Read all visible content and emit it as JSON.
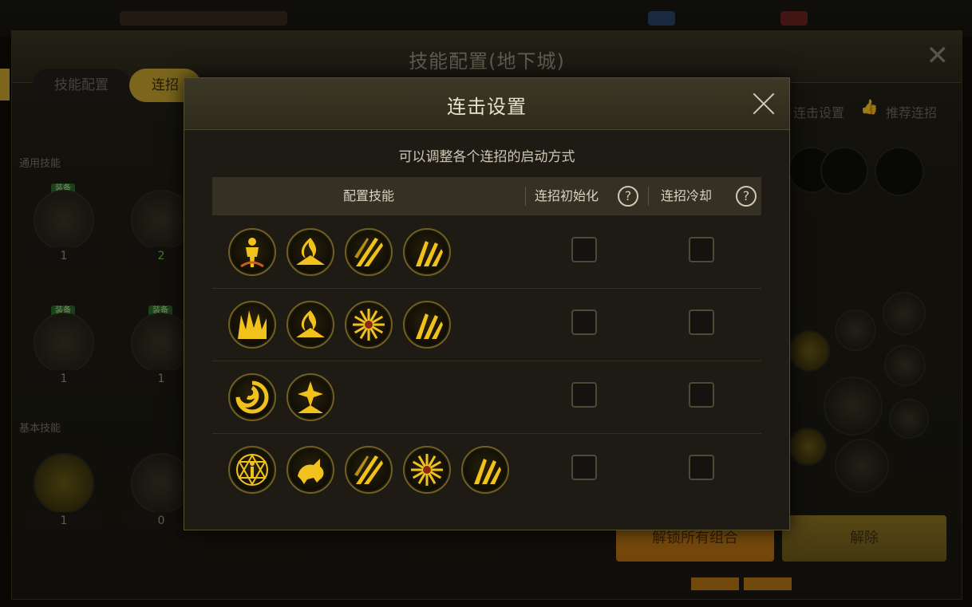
{
  "background": {
    "window_title": "技能配置(地下城)",
    "tabs": [
      {
        "label": "技能配置"
      },
      {
        "label": "连招"
      }
    ],
    "sections": {
      "common": "通用技能",
      "basic": "基本技能"
    },
    "badges": [
      "装备",
      "装备",
      "装备"
    ],
    "skill_levels": [
      "1",
      "2",
      "1",
      "1",
      "1",
      "0"
    ],
    "right_links": {
      "combo_settings": "连击设置",
      "recommended": "推荐连招"
    },
    "buttons": {
      "unlock_all": "解锁所有组合",
      "remove": "解除"
    },
    "colors": {
      "accent_gold": "#c9a52f",
      "orange_button": "#c8801a"
    }
  },
  "modal": {
    "title": "连击设置",
    "subtitle": "可以调整各个连招的启动方式",
    "columns": {
      "skills": "配置技能",
      "combo_init": "连招初始化",
      "combo_cooldown": "连招冷却"
    },
    "help_glyph": "?",
    "rows": [
      {
        "skills": [
          "figure-icon",
          "flame-mound-icon",
          "slash-icon",
          "claw-strike-icon"
        ],
        "combo_init": false,
        "combo_cooldown": false
      },
      {
        "skills": [
          "fire-burst-icon",
          "flame-mound-icon",
          "radial-burst-icon",
          "claw-strike-icon"
        ],
        "combo_init": false,
        "combo_cooldown": false
      },
      {
        "skills": [
          "vortex-icon",
          "rising-star-icon"
        ],
        "combo_init": false,
        "combo_cooldown": false
      },
      {
        "skills": [
          "rune-figure-icon",
          "beast-icon",
          "slash-icon",
          "radial-burst-icon",
          "claw-strike-icon"
        ],
        "combo_init": false,
        "combo_cooldown": false
      }
    ],
    "colors": {
      "icon_gold": "#f2c21c",
      "icon_rim": "#6f5f25"
    }
  }
}
